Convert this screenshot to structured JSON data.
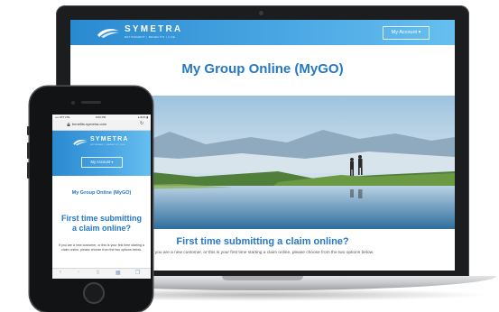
{
  "brand": {
    "name": "SYMETRA",
    "tagline": "RETIREMENT | BENEFITS | LIFE",
    "colors": {
      "header_start": "#2a8ad0",
      "header_end": "#67bff0",
      "accent_text": "#2478c6"
    }
  },
  "laptop": {
    "header": {
      "account_button": "My Account ▾"
    },
    "page_title": "My Group Online (MyGO)",
    "section_title": "First time submitting a claim online?",
    "section_desc": "If you are a new customer, or this is your first time starting a claim online, please choose from the two options below."
  },
  "phone": {
    "status": {
      "carrier": "•••• ATT LTE",
      "time": "9:00 PM",
      "battery": "▸ 81% ▮"
    },
    "url": "benefits.symetra.com",
    "header": {
      "account_button": "My Account ▾"
    },
    "page_title": "My Group Online (MyGO)",
    "section_title": "First time submitting a claim online?",
    "section_desc": "If you are a new customer, or this is your first time starting a claim online, please choose from the two options below.",
    "toolbar_icons": [
      "back-icon",
      "forward-icon",
      "share-icon",
      "bookmarks-icon",
      "tabs-icon"
    ]
  }
}
